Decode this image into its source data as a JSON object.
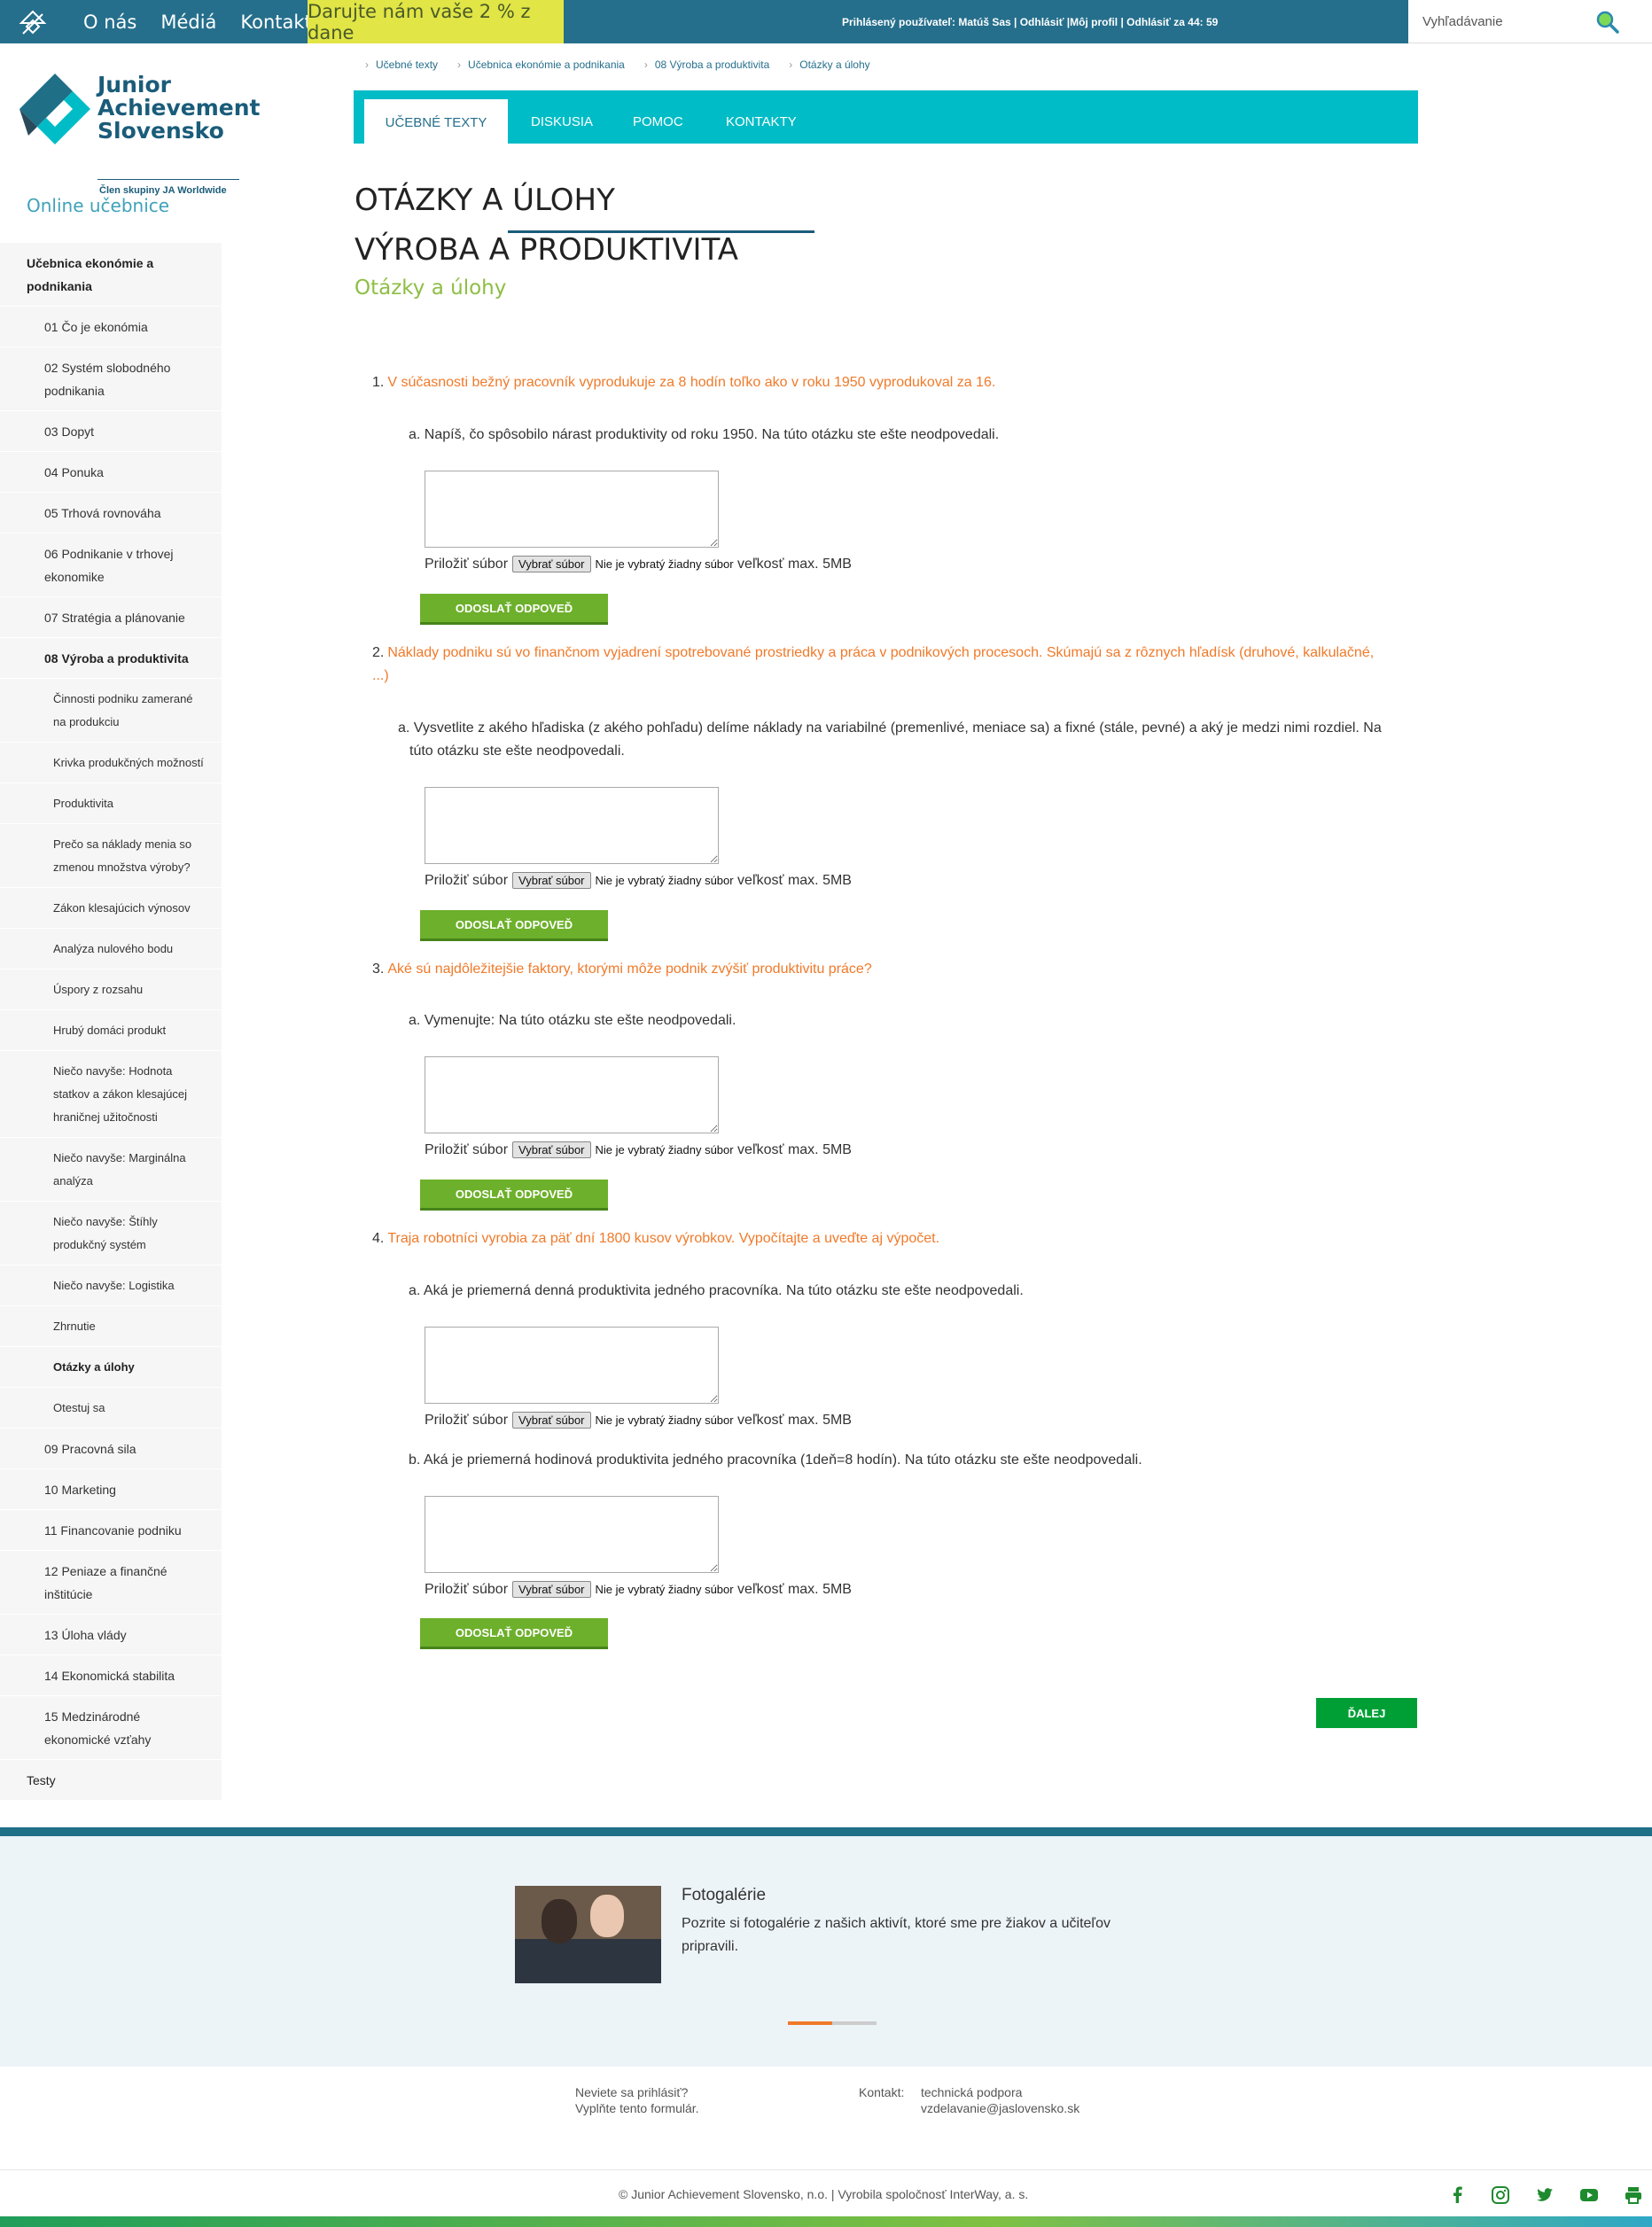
{
  "topbar": {
    "nav": [
      "O nás",
      "Médiá",
      "Kontakt"
    ],
    "donate": "Darujte nám vaše 2 % z dane",
    "user_info": "Prihlásený používateľ: Matúš Sas | Odhlásiť |Môj profil | Odhlásiť za 44: 59",
    "search_placeholder": "Vyhľadávanie"
  },
  "sidebar": {
    "brand": "Junior Achievement Slovensko",
    "brand_l1": "Junior",
    "brand_l2": "Achievement",
    "brand_l3": "Slovensko",
    "tagline": "Člen skupiny JA Worldwide",
    "online": "Online učebnice",
    "menu": [
      {
        "label": "Učebnica ekonómie a podnikania",
        "level": "l1",
        "lines": 2
      },
      {
        "label": "01 Čo je ekonómia",
        "level": "l2"
      },
      {
        "label": "02 Systém slobodného podnikania",
        "level": "l2",
        "lines": 2
      },
      {
        "label": "03 Dopyt",
        "level": "l2"
      },
      {
        "label": "04 Ponuka",
        "level": "l2"
      },
      {
        "label": "05 Trhová rovnováha",
        "level": "l2"
      },
      {
        "label": "06 Podnikanie v trhovej ekonomike",
        "level": "l2",
        "lines": 2
      },
      {
        "label": "07 Stratégia a plánovanie",
        "level": "l2"
      },
      {
        "label": "08 Výroba a produktivita",
        "level": "l2",
        "bold": true
      },
      {
        "label": "Činnosti podniku zamerané na produkciu",
        "level": "l3",
        "lines": 2
      },
      {
        "label": "Krivka produkčných možností",
        "level": "l3"
      },
      {
        "label": "Produktivita",
        "level": "l3"
      },
      {
        "label": "Prečo sa náklady menia so zmenou množstva výroby?",
        "level": "l3",
        "lines": 2
      },
      {
        "label": "Zákon klesajúcich výnosov",
        "level": "l3"
      },
      {
        "label": "Analýza nulového bodu",
        "level": "l3"
      },
      {
        "label": "Úspory z rozsahu",
        "level": "l3"
      },
      {
        "label": "Hrubý domáci produkt",
        "level": "l3"
      },
      {
        "label": "Niečo navyše: Hodnota statkov a zákon klesajúcej hraničnej užitočnosti",
        "level": "l3",
        "lines": 3
      },
      {
        "label": "Niečo navyše: Marginálna analýza",
        "level": "l3",
        "lines": 2
      },
      {
        "label": "Niečo navyše: Štíhly produkčný systém",
        "level": "l3",
        "lines": 2
      },
      {
        "label": "Niečo navyše: Logistika",
        "level": "l3"
      },
      {
        "label": "Zhrnutie",
        "level": "l3"
      },
      {
        "label": "Otázky a úlohy",
        "level": "l3",
        "bold": true
      },
      {
        "label": "Otestuj sa",
        "level": "l3"
      },
      {
        "label": "09 Pracovná sila",
        "level": "l2"
      },
      {
        "label": "10 Marketing",
        "level": "l2"
      },
      {
        "label": "11 Financovanie podniku",
        "level": "l2"
      },
      {
        "label": "12 Peniaze a finančné inštitúcie",
        "level": "l2",
        "lines": 2
      },
      {
        "label": "13 Úloha vlády",
        "level": "l2"
      },
      {
        "label": "14 Ekonomická stabilita",
        "level": "l2"
      },
      {
        "label": "15 Medzinárodné ekonomické vzťahy",
        "level": "l2",
        "lines": 2
      },
      {
        "label": "Testy",
        "level": "l1n"
      }
    ]
  },
  "breadcrumb": [
    "Učebné texty",
    "Učebnica ekonómie a podnikania",
    "08 Výroba a produktivita",
    "Otázky a úlohy"
  ],
  "tabs": [
    "UČEBNÉ TEXTY",
    "DISKUSIA",
    "POMOC",
    "KONTAKTY"
  ],
  "title1": "OTÁZKY A ÚLOHY",
  "title2": "VÝROBA A PRODUKTIVITA",
  "subtitle": "Otázky a úlohy",
  "questions": [
    {
      "num": "1.",
      "text": "V súčasnosti bežný pracovník vyprodukuje za 8 hodín toľko ako v roku 1950 vyprodukoval za 16."
    },
    {
      "num": "2.",
      "text": "Náklady podniku sú vo finančnom vyjadrení spotrebované prostriedky a práca v podnikových procesoch. Skúmajú sa z rôznych hľadísk (druhové, kalkulačné, ...)"
    },
    {
      "num": "3.",
      "text": "Aké sú najdôležitejšie faktory, ktorými môže podnik zvýšiť produktivitu práce?"
    },
    {
      "num": "4.",
      "text": "Traja robotníci vyrobia za päť dní 1800 kusov výrobkov. Vypočítajte a uveďte aj výpočet."
    }
  ],
  "subquestions": [
    "a. Napíš, čo spôsobilo nárast produktivity od roku 1950. Na túto otázku ste ešte neodpovedali.",
    "a. Vysvetlite z akého hľadiska (z akého pohľadu) delíme náklady na variabilné (premenlivé, meniace sa) a fixné (stále, pevné) a aký je medzi nimi rozdiel. Na túto otázku ste ešte neodpovedali.",
    "a. Vymenujte: Na túto otázku ste ešte neodpovedali.",
    "a. Aká je priemerná denná produktivita jedného pracovníka. Na túto otázku ste ešte neodpovedali.",
    "b. Aká je priemerná hodinová produktivita jedného pracovníka (1deň=8 hodín). Na túto otázku ste ešte neodpovedali."
  ],
  "attach": {
    "label": "Priložiť súbor",
    "button": "Vybrať súbor",
    "nofile": "Nie je vybratý žiadny súbor",
    "size": "veľkosť max. 5MB"
  },
  "send_label": "ODOSLAŤ ODPOVEĎ",
  "next_label": "ĎALEJ",
  "footer": {
    "gallery_title": "Fotogalérie",
    "gallery_desc": "Pozrite si fotogalérie z našich aktivít, ktoré sme pre žiakov a učiteľov pripravili.",
    "login_l1": "Neviete sa prihlásiť?",
    "login_l2": "Vyplňte tento formulár.",
    "contact_label": "Kontakt:",
    "contact_l1": "technická podpora",
    "contact_l2": "vzdelavanie@jaslovensko.sk",
    "copyright": "© Junior Achievement Slovensko, n.o. | Vyrobila spoločnosť InterWay, a. s."
  },
  "colors": {
    "topbar": "#256f8c",
    "tabs": "#00bcc6",
    "accent_orange": "#f07a2a",
    "accent_green": "#8dbe44",
    "button_green": "#6db02b",
    "donate": "#e1e545"
  }
}
